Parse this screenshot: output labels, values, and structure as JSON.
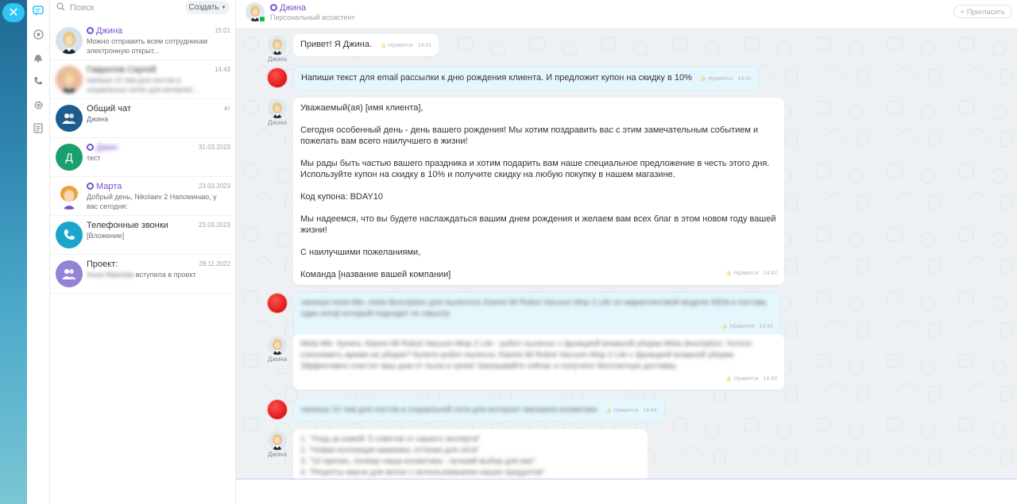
{
  "sidebar": {
    "close_icon": "close-icon",
    "icons": [
      "chat-icon",
      "notifications-icon",
      "bell-icon",
      "phone-icon",
      "gear-icon",
      "tasks-icon"
    ]
  },
  "chatlist": {
    "search_placeholder": "Поиск",
    "create_label": "Создать",
    "items": [
      {
        "name": "Джина",
        "bot": true,
        "date": "15:01",
        "preview": "Можно отправить всем сотрудникам электронную открыт...",
        "avatar": "photo",
        "color": "#d6e3ee"
      },
      {
        "name": "Гаврилов Сергей",
        "blur": true,
        "date": "14:43",
        "preview": "напиши 10 тем для постов в социальных сетях для интернет...",
        "avatar": "photo",
        "color": "#e8b9a0"
      },
      {
        "name": "Общий чат",
        "date": "вт",
        "preview": "Джина",
        "avatar": "group-icon",
        "color": "#1d5c8c"
      },
      {
        "name": "Джин",
        "bot": true,
        "blurname": true,
        "date": "31.03.2023",
        "preview": "тест",
        "avatar": "Д",
        "color": "#1aa06d"
      },
      {
        "name": "Марта",
        "bot": true,
        "date": "23.03.2023",
        "preview": "Добрый день, Nikolaev 2 Напоминаю, у вас сегодня:",
        "avatar": "girl",
        "color": "#f6d07a"
      },
      {
        "name": "Телефонные звонки",
        "date": "23.03.2023",
        "preview": "[Вложение]",
        "avatar": "phone-icon",
        "color": "#19a6cc"
      },
      {
        "name": "Проект:",
        "date": "28.11.2022",
        "preview": "вступила в проект",
        "preview_blur": "Анна Иванова",
        "avatar": "group-icon",
        "color": "#9482d6"
      }
    ]
  },
  "header": {
    "name": "Джина",
    "subtitle": "Персональный ассистент",
    "invite": "Пригласить"
  },
  "like_label": "Нравится",
  "bot_label": "Джина",
  "messages": [
    {
      "from": "bot",
      "text": "Привет! Я Джина.",
      "time": "14:41"
    },
    {
      "from": "user",
      "text": "Напиши текст для email рассылки к дню рождения клиента. И предложит купон на скидку в 10%",
      "time": "14:41"
    },
    {
      "from": "bot",
      "time": "14:42",
      "paras": [
        "Уважаемый(ая) [имя клиента],",
        "Сегодня особенный день - день вашего рождения! Мы хотим поздравить вас с этим замечательным событием и пожелать вам всего наилучшего в жизни!",
        "Мы рады быть частью вашего праздника и хотим подарить вам наше специальное предложение в честь этого дня. Используйте купон на скидку в 10% и получите скидку на любую покупку в нашем магазине.",
        "Код купона: BDAY10",
        "Мы надеемся, что вы будете наслаждаться вашим днем рождения и желаем вам всех благ в этом новом году вашей жизни!",
        "С наилучшими пожеланиями,",
        "Команда [название вашей компании]"
      ]
    },
    {
      "from": "user",
      "blur": true,
      "time": "14:42",
      "text": "напиши meta title, meta description для пылесоса Xiaomi Mi Robot Vacuum Mop 2 Lite по маркетинговой модели AIDA и поставь один emoji который подходит по смыслу"
    },
    {
      "from": "bot",
      "blur": true,
      "time": "14:43",
      "text": "Meta title: Купить Xiaomi Mi Robot Vacuum-Mop 2 Lite - робот-пылесос с функцией влажной уборки Meta description: Хотите сэкономить время на уборке? Купите робот-пылесос Xiaomi Mi Robot Vacuum-Mop 2 Lite с функцией влажной уборки. Эффективно очистит ваш дом от пыли и грязи! Заказывайте сейчас и получите бесплатную доставку."
    },
    {
      "from": "user",
      "blur": true,
      "time": "14:44",
      "text": "напиши 10 тем для постов в социальной сети для интернет магазина косметики"
    },
    {
      "from": "bot",
      "blur": true,
      "time": "",
      "lines": [
        "1. \"Уход за кожей: 5 советов от нашего эксперта\"",
        "2. \"Новая коллекция макияжа: оттенки для лета\"",
        "3. \"10 причин, почему наша косметика - лучший выбор для вас\"",
        "4. \"Рецепты масок для волос с использованием наших продуктов\""
      ]
    }
  ]
}
